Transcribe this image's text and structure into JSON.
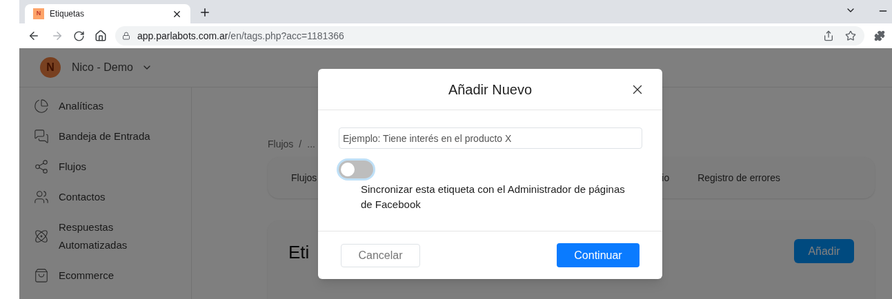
{
  "browser": {
    "tab": {
      "favicon_letter": "N",
      "title": "Etiquetas"
    },
    "url": {
      "host": "app.parlabots.com.ar",
      "path": "/en/tags.php?acc=1181366"
    }
  },
  "header": {
    "avatar_initial": "N",
    "account_name": "Nico - Demo"
  },
  "sidebar": {
    "items": [
      {
        "label": "Analíticas"
      },
      {
        "label": "Bandeja de Entrada"
      },
      {
        "label": "Flujos"
      },
      {
        "label": "Contactos"
      },
      {
        "label": "Respuestas Automatizadas"
      },
      {
        "label": "Ecommerce"
      }
    ]
  },
  "breadcrumb": {
    "items": [
      "Flujos",
      "..."
    ],
    "separator": "/"
  },
  "tabs": [
    {
      "label": "Flujos"
    },
    {
      "label": "io"
    },
    {
      "label": "Registro de errores"
    }
  ],
  "tags_card": {
    "heading": "Eti",
    "add_button": "Añadir"
  },
  "dialog": {
    "title": "Añadir Nuevo",
    "input": {
      "placeholder": "Ejemplo: Tiene interés en el producto X"
    },
    "toggle": {
      "on": false,
      "label": "Sincronizar esta etiqueta con el Administrador de páginas de Facebook"
    },
    "cancel_button": "Cancelar",
    "continue_button": "Continuar"
  }
}
